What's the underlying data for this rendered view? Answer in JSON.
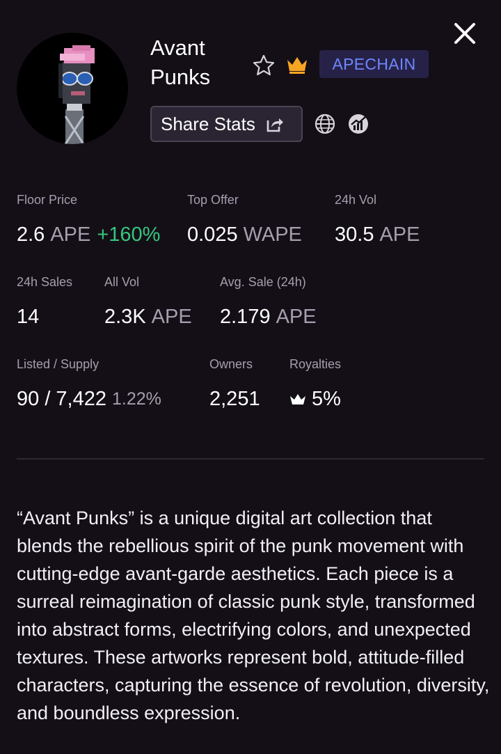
{
  "collection": {
    "name_line1": "Avant",
    "name_line2": "Punks",
    "chain": "APECHAIN"
  },
  "actions": {
    "share_label": "Share Stats"
  },
  "stats": {
    "floor_price": {
      "label": "Floor Price",
      "value": "2.6",
      "unit": "APE",
      "change": "+160%"
    },
    "top_offer": {
      "label": "Top Offer",
      "value": "0.025",
      "unit": "WAPE"
    },
    "vol_24h": {
      "label": "24h Vol",
      "value": "30.5",
      "unit": "APE"
    },
    "sales_24h": {
      "label": "24h Sales",
      "value": "14"
    },
    "all_vol": {
      "label": "All Vol",
      "value": "2.3K",
      "unit": "APE"
    },
    "avg_sale": {
      "label": "Avg. Sale (24h)",
      "value": "2.179",
      "unit": "APE"
    },
    "listed_supply": {
      "label": "Listed / Supply",
      "value": "90 / 7,422",
      "pct": "1.22%"
    },
    "owners": {
      "label": "Owners",
      "value": "2,251"
    },
    "royalties": {
      "label": "Royalties",
      "value": "5%"
    }
  },
  "description": "“Avant Punks” is a unique digital art collection that blends the rebellious spirit of the punk movement with cutting-edge avant-garde aesthetics. Each piece is a surreal reimagination of classic punk style, transformed into abstract forms, electrifying colors, and unexpected textures. These artworks represent bold, attitude-filled characters, capturing the essence of revolution, diversity, and boundless expression.",
  "colors": {
    "background": "#140f17",
    "positive": "#35c77e",
    "crown": "#f6a623",
    "chain_badge_text": "#6f86ff",
    "muted_text": "#a59fae"
  },
  "icons": [
    "close-icon",
    "star-icon",
    "crown-icon",
    "share-icon",
    "globe-icon",
    "chart-icon"
  ]
}
